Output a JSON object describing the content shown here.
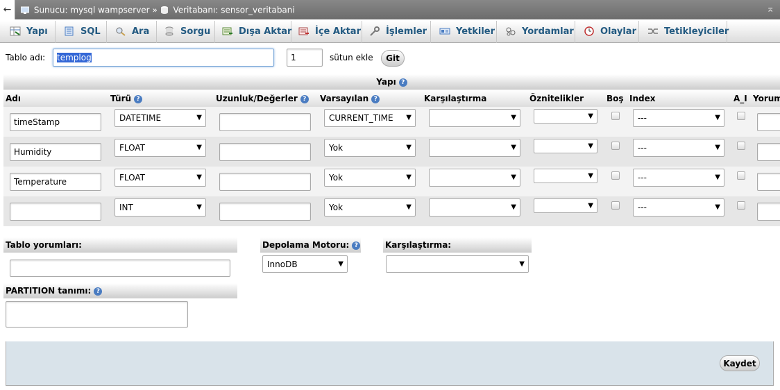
{
  "breadcrumb": {
    "back": "←",
    "server_label": "Sunucu:",
    "server_name": "mysql wampserver",
    "sep": "»",
    "db_label": "Veritabanı:",
    "db_name": "sensor_veritabani",
    "collapse": "⌅"
  },
  "tabs": [
    {
      "label": "Yapı",
      "icon": "structure-icon"
    },
    {
      "label": "SQL",
      "icon": "sql-icon"
    },
    {
      "label": "Ara",
      "icon": "search-icon"
    },
    {
      "label": "Sorgu",
      "icon": "query-icon"
    },
    {
      "label": "Dışa Aktar",
      "icon": "export-icon"
    },
    {
      "label": "İçe Aktar",
      "icon": "import-icon"
    },
    {
      "label": "İşlemler",
      "icon": "operations-icon"
    },
    {
      "label": "Yetkiler",
      "icon": "privileges-icon"
    },
    {
      "label": "Yordamlar",
      "icon": "routines-icon"
    },
    {
      "label": "Olaylar",
      "icon": "events-icon"
    },
    {
      "label": "Tetikleyiciler",
      "icon": "triggers-icon"
    }
  ],
  "table_form": {
    "name_label": "Tablo adı:",
    "name_value": "templog",
    "add_count": "1",
    "add_label": "sütun ekle",
    "go_button": "Git"
  },
  "structure": {
    "title": "Yapı",
    "columns": [
      "Adı",
      "Türü",
      "Uzunluk/Değerler",
      "Varsayılan",
      "Karşılaştırma",
      "Öznitelikler",
      "Boş",
      "Index",
      "A_I",
      "Yorum"
    ],
    "rows": [
      {
        "name": "timeStamp",
        "type": "DATETIME",
        "length": "",
        "default": "CURRENT_TIME",
        "collation": "",
        "attributes": "",
        "index": "---"
      },
      {
        "name": "Humidity",
        "type": "FLOAT",
        "length": "",
        "default": "Yok",
        "collation": "",
        "attributes": "",
        "index": "---"
      },
      {
        "name": "Temperature",
        "type": "FLOAT",
        "length": "",
        "default": "Yok",
        "collation": "",
        "attributes": "",
        "index": "---"
      },
      {
        "name": "",
        "type": "INT",
        "length": "",
        "default": "Yok",
        "collation": "",
        "attributes": "",
        "index": "---"
      }
    ]
  },
  "options": {
    "comments_label": "Tablo yorumları:",
    "comments_value": "",
    "engine_label": "Depolama Motoru:",
    "engine_value": "InnoDB",
    "collation_label": "Karşılaştırma:",
    "collation_value": "",
    "partition_label": "PARTITION tanımı:"
  },
  "save_button": "Kaydet",
  "help_glyph": "?",
  "arrow_glyph": "▼",
  "colors": {
    "link": "#235a81",
    "help": "#4a7cc1",
    "footer": "#d9e3ea"
  }
}
